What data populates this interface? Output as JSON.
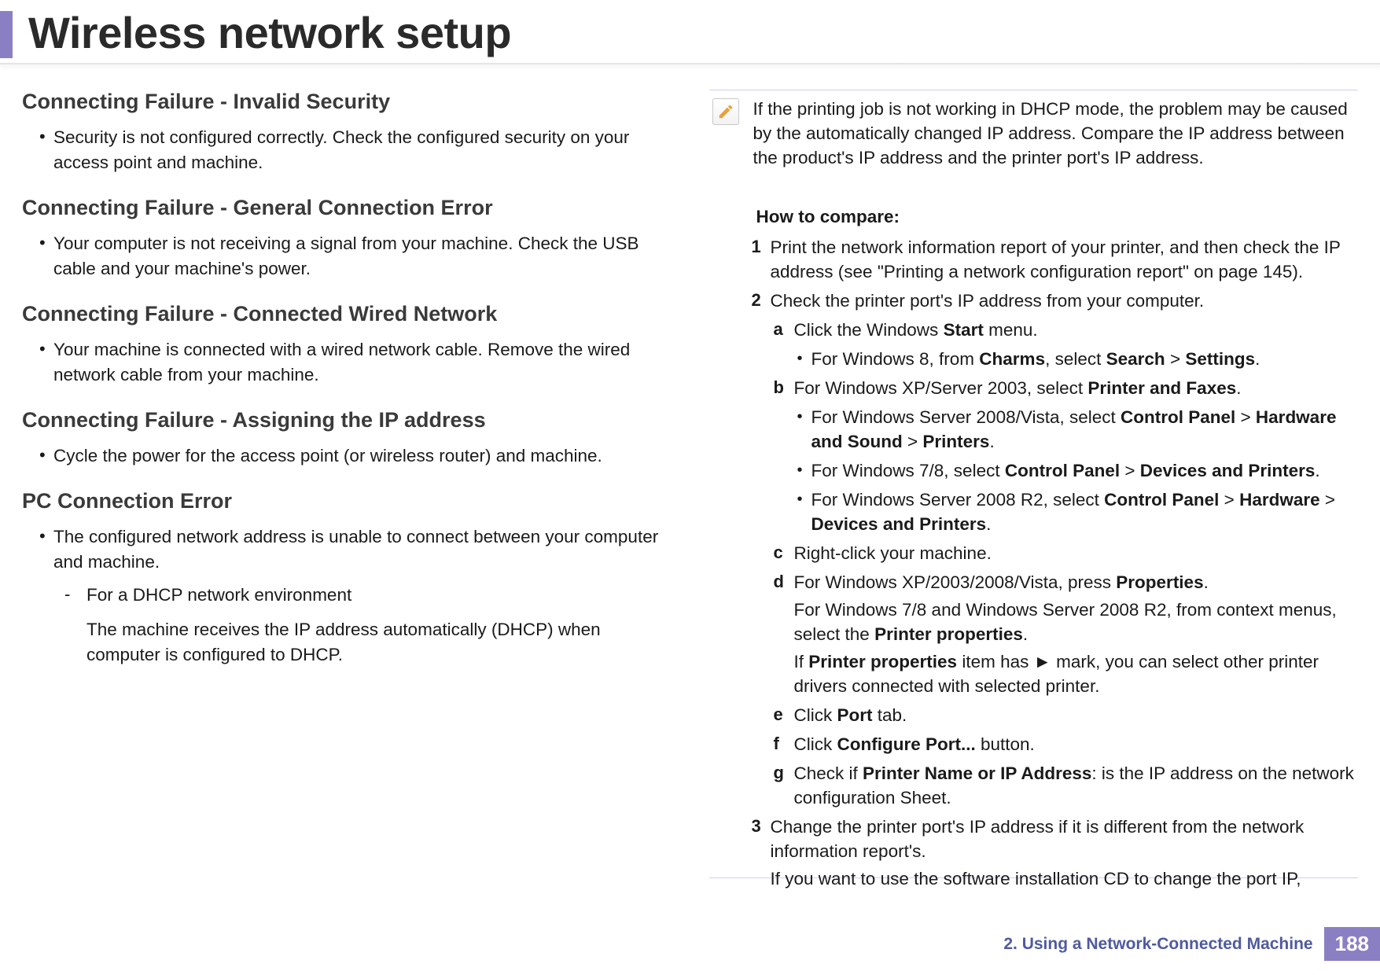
{
  "title": "Wireless network setup",
  "sections": [
    {
      "heading": "Connecting Failure - Invalid Security",
      "bullet": "Security is not configured correctly. Check the configured security on your access point and machine."
    },
    {
      "heading": "Connecting Failure - General Connection Error",
      "bullet": "Your computer is not receiving a signal from your machine. Check the USB cable and your machine's power."
    },
    {
      "heading": "Connecting Failure - Connected Wired Network",
      "bullet": "Your machine is connected with a wired network cable. Remove the wired network cable from your machine."
    },
    {
      "heading": "Connecting Failure - Assigning the IP address",
      "bullet": "Cycle the power for the access point (or wireless router) and machine."
    }
  ],
  "pc": {
    "heading": "PC Connection Error",
    "bullet": "The configured network address is unable to connect between your computer and machine.",
    "sub_label": "For a DHCP network environment",
    "sub_text": "The machine receives the IP address automatically (DHCP) when computer is configured to DHCP."
  },
  "note": "If the printing job is not working in DHCP mode, the problem may be caused by the automatically changed IP address. Compare the IP address between the product's IP address and the printer port's IP address.",
  "compare_heading": "How to compare:",
  "step1": {
    "marker": "1",
    "text": "Print the network information report of your printer, and then check the IP address (see \"Printing a network configuration report\" on page 145)."
  },
  "step2": {
    "marker": "2",
    "text": "Check the printer port's IP address from your computer.",
    "a": {
      "marker": "a",
      "pre": "Click the Windows ",
      "b1": "Start",
      "post": " menu."
    },
    "a_sub": {
      "pre": "For Windows 8, from ",
      "b1": "Charms",
      "mid1": ", select ",
      "b2": "Search",
      "mid2": " > ",
      "b3": "Settings",
      "post": "."
    },
    "b": {
      "marker": "b",
      "pre": "For Windows XP/Server 2003, select ",
      "b1": "Printer and Faxes",
      "post": "."
    },
    "b_sub1": {
      "pre": "For Windows Server 2008/Vista, select ",
      "b1": "Control Panel",
      "mid1": " > ",
      "b2": "Hardware and Sound",
      "mid2": " > ",
      "b3": "Printers",
      "post": "."
    },
    "b_sub2": {
      "pre": "For Windows 7/8, select ",
      "b1": "Control Panel",
      "mid1": " > ",
      "b2": "Devices and Printers",
      "post": "."
    },
    "b_sub3": {
      "pre": "For Windows Server 2008 R2, select ",
      "b1": "Control Panel",
      "mid1": " > ",
      "b2": "Hardware",
      "mid2": " > ",
      "b3": "Devices and Printers",
      "post": "."
    },
    "c": {
      "marker": "c",
      "text": "Right-click your machine."
    },
    "d": {
      "marker": "d",
      "pre": "For Windows XP/2003/2008/Vista, press ",
      "b1": "Properties",
      "post": "."
    },
    "d_p1": {
      "pre": "For Windows 7/8 and Windows Server 2008 R2, from context menus, select the ",
      "b1": "Printer properties",
      "post": "."
    },
    "d_p2": {
      "pre": "If ",
      "b1": "Printer properties",
      "post": " item has ► mark, you can select other printer drivers connected with selected printer."
    },
    "e": {
      "marker": "e",
      "pre": "Click ",
      "b1": "Port",
      "post": " tab."
    },
    "f": {
      "marker": "f",
      "pre": "Click ",
      "b1": "Configure Port...",
      "post": " button."
    },
    "g": {
      "marker": "g",
      "pre": "Check if ",
      "b1": "Printer Name or IP Address",
      "post": ": is the IP address on the network configuration Sheet."
    }
  },
  "step3": {
    "marker": "3",
    "text": "Change the printer port's IP address if it is different from the network information report's.",
    "p1": "If you  want to use the software installation CD to change the port IP,"
  },
  "footer": {
    "chapter": "2.  Using a Network-Connected Machine",
    "page": "188"
  }
}
